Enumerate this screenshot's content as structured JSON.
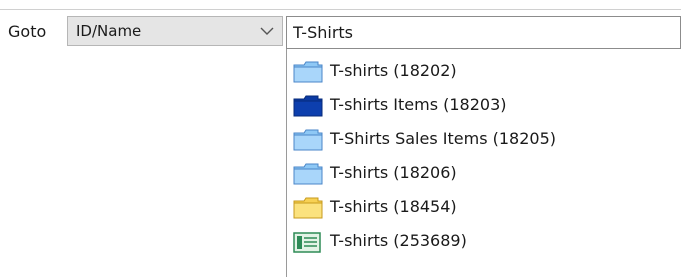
{
  "toolbar": {
    "goto_label": "Goto",
    "mode_select": {
      "selected": "ID/Name"
    }
  },
  "search": {
    "value": "T-Shirts"
  },
  "results": [
    {
      "label": "T-shirts (18202)",
      "icon": "folder-light-blue-icon"
    },
    {
      "label": "T-shirts Items (18203)",
      "icon": "folder-dark-blue-icon"
    },
    {
      "label": "T-Shirts Sales Items (18205)",
      "icon": "folder-light-blue-icon"
    },
    {
      "label": "T-shirts (18206)",
      "icon": "folder-light-blue-icon"
    },
    {
      "label": "T-shirts (18454)",
      "icon": "folder-yellow-icon"
    },
    {
      "label": "T-shirts (253689)",
      "icon": "list-document-icon"
    }
  ],
  "colors": {
    "folder_light_blue": "#8ec8f5",
    "folder_dark_blue": "#0b3aa3",
    "folder_yellow": "#f7d154",
    "document_green": "#2e8b57"
  }
}
